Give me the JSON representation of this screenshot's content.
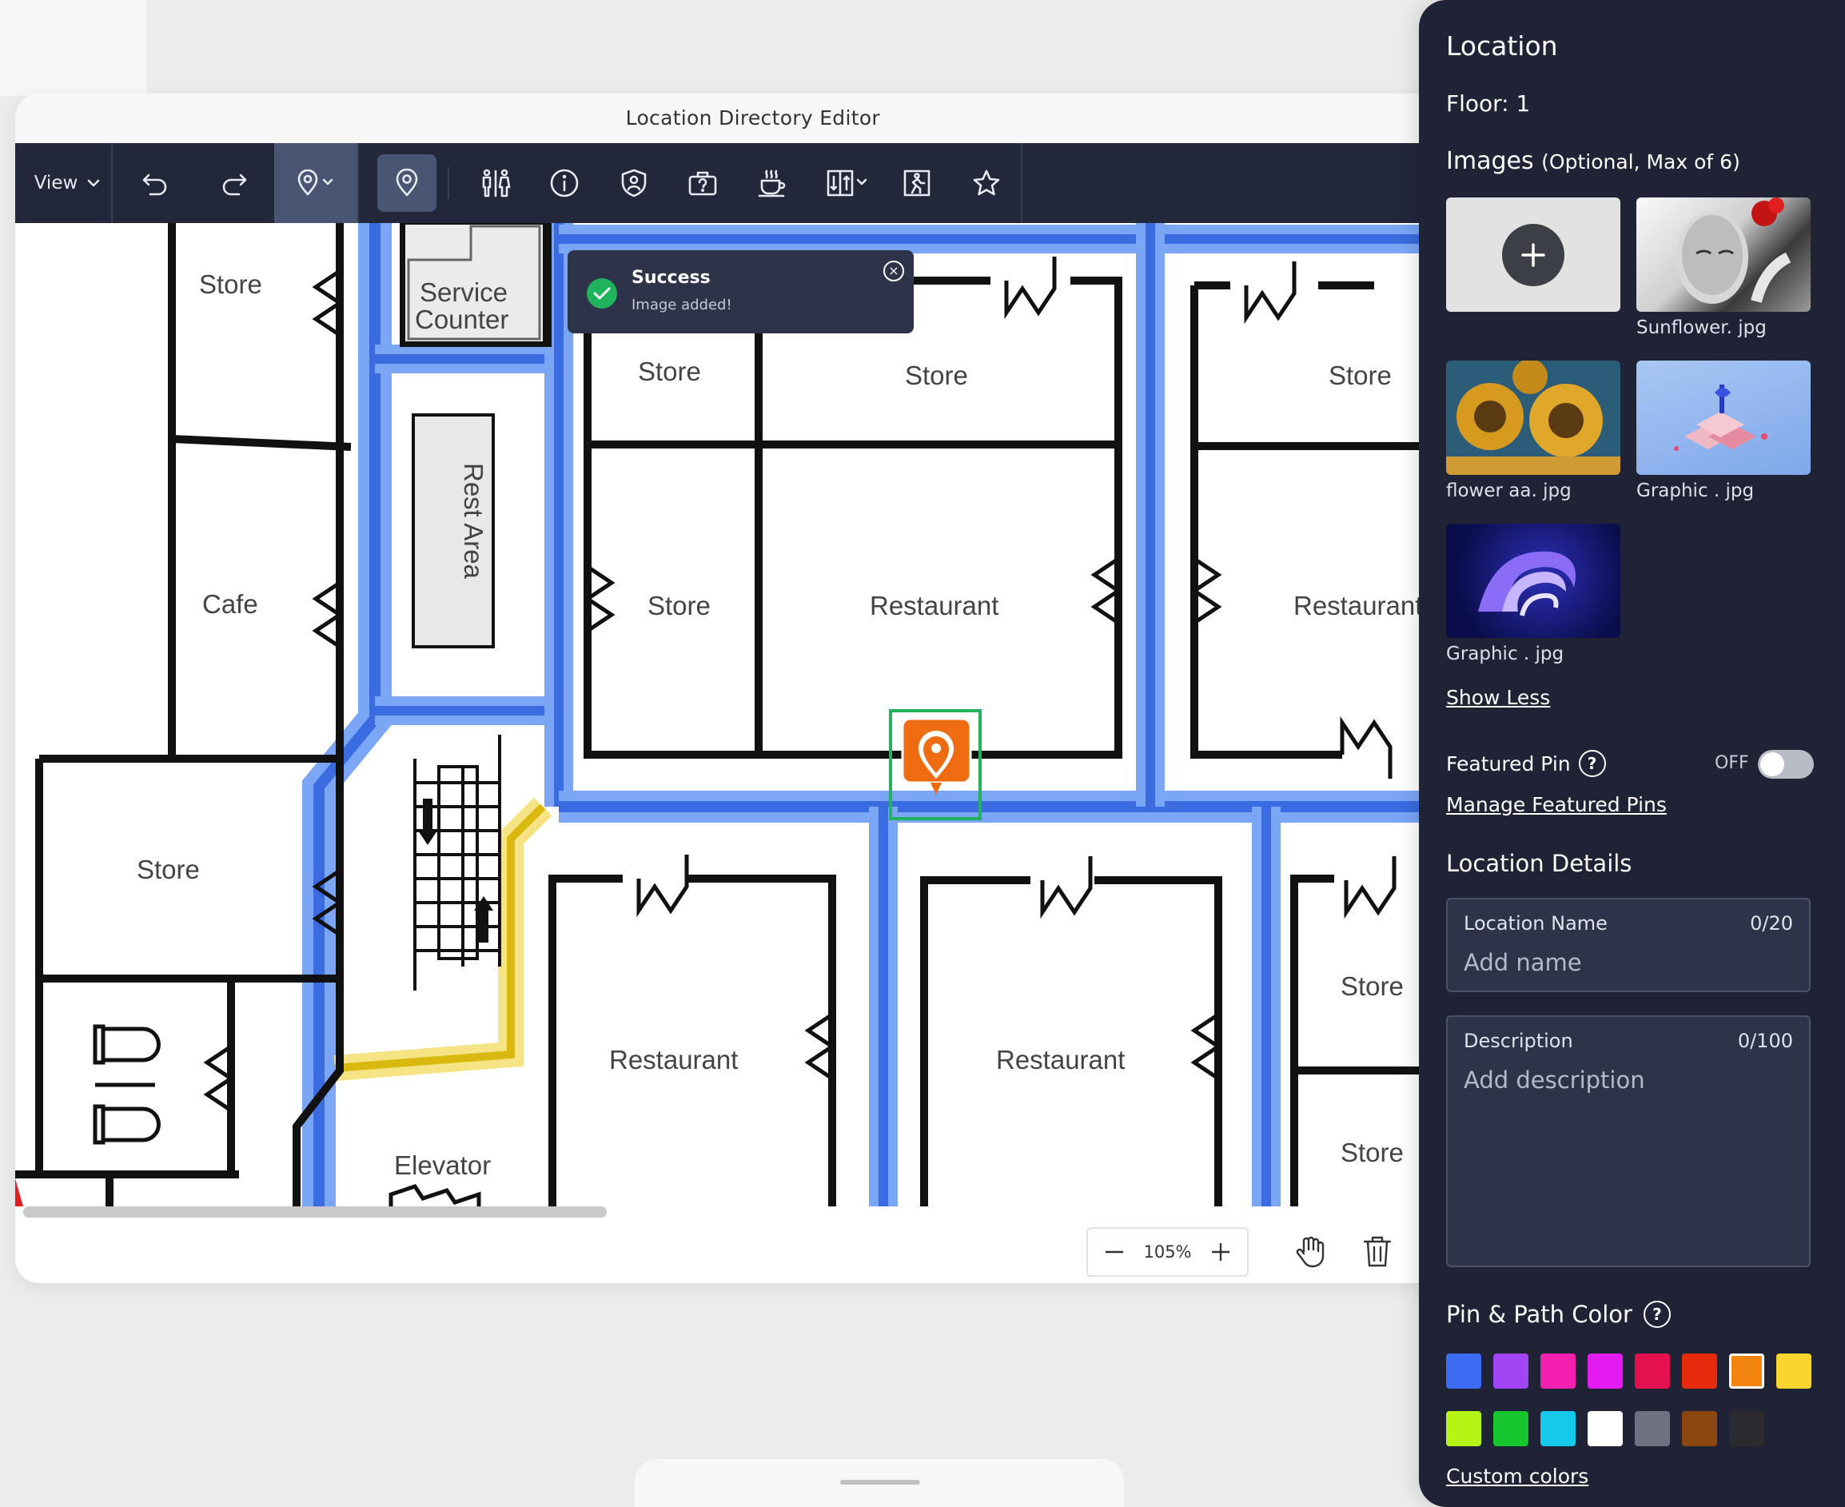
{
  "window": {
    "title": "Location Directory Editor"
  },
  "toolbar": {
    "view_label": "View",
    "icons": [
      "undo-icon",
      "redo-icon",
      "location-pin-dropdown-icon",
      "location-pin-icon",
      "restroom-icon",
      "info-icon",
      "security-icon",
      "lost-and-found-icon",
      "cafe-icon",
      "elevator-icon",
      "exit-icon",
      "star-icon"
    ]
  },
  "map": {
    "rooms": {
      "store_tl": "Store",
      "service_counter_1": "Service",
      "service_counter_2": "Counter",
      "rest_area": "Rest Area",
      "cafe": "Cafe",
      "store_left": "Store",
      "store_top1": "Store",
      "store_top2": "Store",
      "store_top3": "Store",
      "store_mid": "Store",
      "restaurant_mid": "Restaurant",
      "restaurant_right": "Restaurant",
      "restaurant_bl": "Restaurant",
      "restaurant_bc": "Restaurant",
      "store_br1": "Store",
      "store_br2": "Store",
      "elevator": "Elevator"
    }
  },
  "zoom": {
    "level": "105%"
  },
  "toast": {
    "title": "Success",
    "message": "Image added!"
  },
  "panel": {
    "title": "Location",
    "floor": "Floor: 1",
    "images_label": "Images",
    "images_hint": "(Optional, Max of 6)",
    "images": [
      {
        "caption": "Sunflower. jpg"
      },
      {
        "caption": "flower aa. jpg"
      },
      {
        "caption": "Graphic . jpg"
      },
      {
        "caption": "Graphic . jpg"
      }
    ],
    "show_less": "Show Less",
    "featured_pin": {
      "label": "Featured Pin",
      "state": "OFF"
    },
    "manage_featured": "Manage Featured Pins",
    "location_details": "Location Details",
    "location_name": {
      "label": "Location Name",
      "counter": "0/20",
      "placeholder": "Add name",
      "value": ""
    },
    "description": {
      "label": "Description",
      "counter": "0/100",
      "placeholder": "Add description",
      "value": ""
    },
    "pin_path_color": "Pin & Path Color",
    "colors": [
      "#3d6cf4",
      "#a245f5",
      "#f51faf",
      "#e41bf0",
      "#e5104f",
      "#e52a0d",
      "#f28510",
      "#fad52e",
      "#b5f515",
      "#17c52e",
      "#15c9ed",
      "#ffffff",
      "#6e7280",
      "#8c4711",
      "#2b2b2f"
    ],
    "selected_color": "#f28510",
    "custom_colors": "Custom colors"
  }
}
